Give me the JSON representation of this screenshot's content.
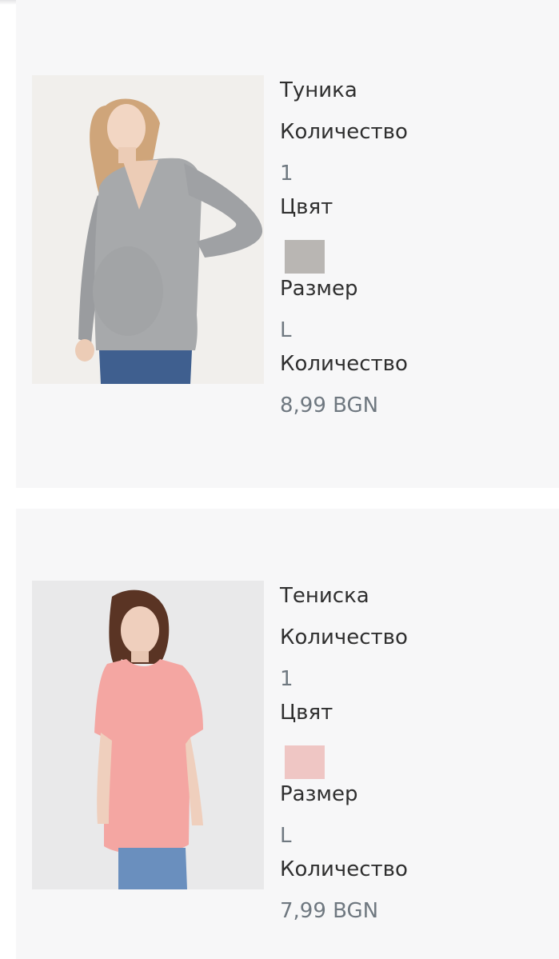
{
  "products": [
    {
      "name": "Туника",
      "quantity_label": "Количество",
      "quantity": "1",
      "color_label": "Цвят",
      "color_swatch": "#b9b6b3",
      "size_label": "Размер",
      "size": "L",
      "price_label": "Количество",
      "price": "8,99 BGN"
    },
    {
      "name": "Тениска",
      "quantity_label": "Количество",
      "quantity": "1",
      "color_label": "Цвят",
      "color_swatch": "#efc6c4",
      "size_label": "Размер",
      "size": "L",
      "price_label": "Количество",
      "price": "7,99 BGN"
    }
  ]
}
